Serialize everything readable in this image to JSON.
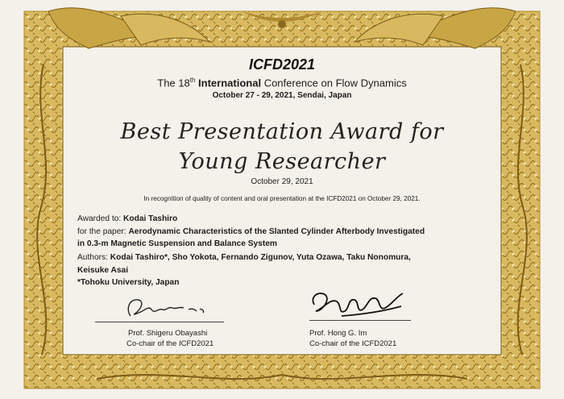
{
  "conference": {
    "title": "ICFD2021",
    "subtitle_pre": "The 18",
    "subtitle_sup": "th",
    "subtitle_bold": "International",
    "subtitle_post": "Conference on Flow Dynamics",
    "dates_place": "October 27 - 29, 2021, Sendai, Japan"
  },
  "award": {
    "line1": "Best Presentation Award for",
    "line2": "Young Researcher",
    "date": "October 29, 2021"
  },
  "recognition": "In recognition of quality of content and oral presentation at the ICFD2021 on October 29, 2021.",
  "recipient": {
    "awarded_label": "Awarded to:",
    "awarded_name": "Kodai Tashiro",
    "paper_label": "for the paper:",
    "paper_title_1": "Aerodynamic Characteristics of the Slanted Cylinder Afterbody Investigated",
    "paper_title_2": "in 0.3-m Magnetic Suspension and Balance System",
    "authors_label": "Authors:",
    "authors_1": "Kodai Tashiro*, Sho Yokota, Fernando Zigunov, Yuta Ozawa, Taku Nonomura,",
    "authors_2": "Keisuke Asai",
    "affiliation": "*Tohoku University, Japan"
  },
  "signatories": [
    {
      "name": "Prof. Shigeru Obayashi",
      "role": "Co-chair of the ICFD2021"
    },
    {
      "name": "Prof. Hong G. Im",
      "role": "Co-chair of the ICFD2021"
    }
  ],
  "colors": {
    "paper": "#f3f1ea",
    "border_gold": "#c9a645",
    "border_dark": "#8a6a1e",
    "text": "#1c1c1c"
  }
}
